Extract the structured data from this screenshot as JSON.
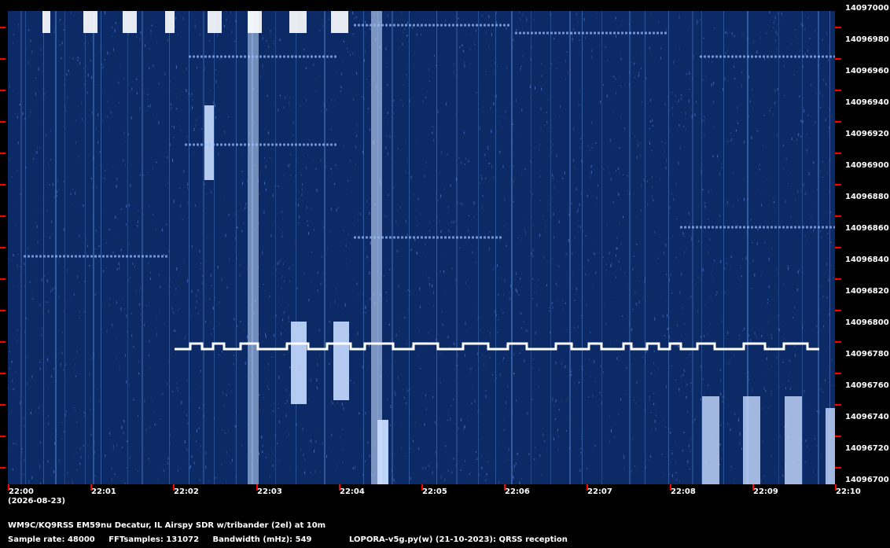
{
  "waterfall": {
    "background": "#0b2a66",
    "signal_color": "#ffffff",
    "tick_color": "#ff0000"
  },
  "freq_axis": {
    "labels": [
      "14097000",
      "14096980",
      "14096960",
      "14096940",
      "14096920",
      "14096900",
      "14096880",
      "14096860",
      "14096840",
      "14096820",
      "14096800",
      "14096780",
      "14096760",
      "14096740",
      "14096720",
      "14096700"
    ]
  },
  "time_axis": {
    "labels": [
      "22:00",
      "22:01",
      "22:02",
      "22:03",
      "22:04",
      "22:05",
      "22:06",
      "22:07",
      "22:08",
      "22:09",
      "22:10"
    ],
    "date": "(2026-08-23)"
  },
  "footer": {
    "station": "WM9C/KQ9RSS EM59nu Decatur, IL  Airspy SDR w/tribander (2el) at 10m",
    "sample_rate": "Sample rate: 48000",
    "fft_samples": "FFTsamples: 131072",
    "bandwidth": "Bandwidth (mHz): 549",
    "software": "LOPORA-v5g.py(w) (21-10-2023): QRSS reception"
  }
}
